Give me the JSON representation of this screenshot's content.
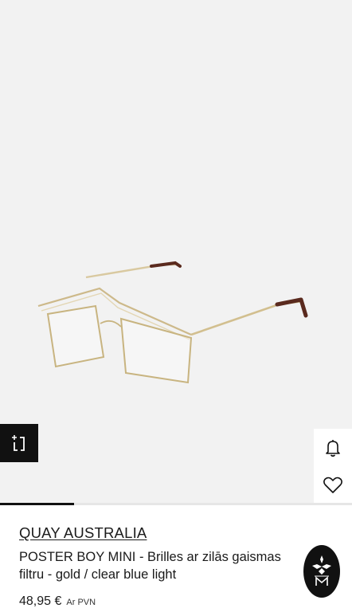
{
  "product": {
    "brand": "QUAY AUSTRALIA",
    "name": "POSTER BOY MINI",
    "description": " - Brilles ar zilās gaismas filtru - gold / clear blue light",
    "price": "48,95 €",
    "vat_note": "Ar PVN"
  },
  "gallery": {
    "progress_fraction": 0.21
  },
  "icons": {
    "ar_view": "ar-view-icon",
    "notify": "bell-icon",
    "wishlist": "heart-icon",
    "seller": "seller-logo-icon"
  },
  "colors": {
    "hero_bg": "#f2f2f2",
    "dark": "#111111",
    "frame_gold": "#c9b27a",
    "temple_tip": "#5a2a1e"
  }
}
